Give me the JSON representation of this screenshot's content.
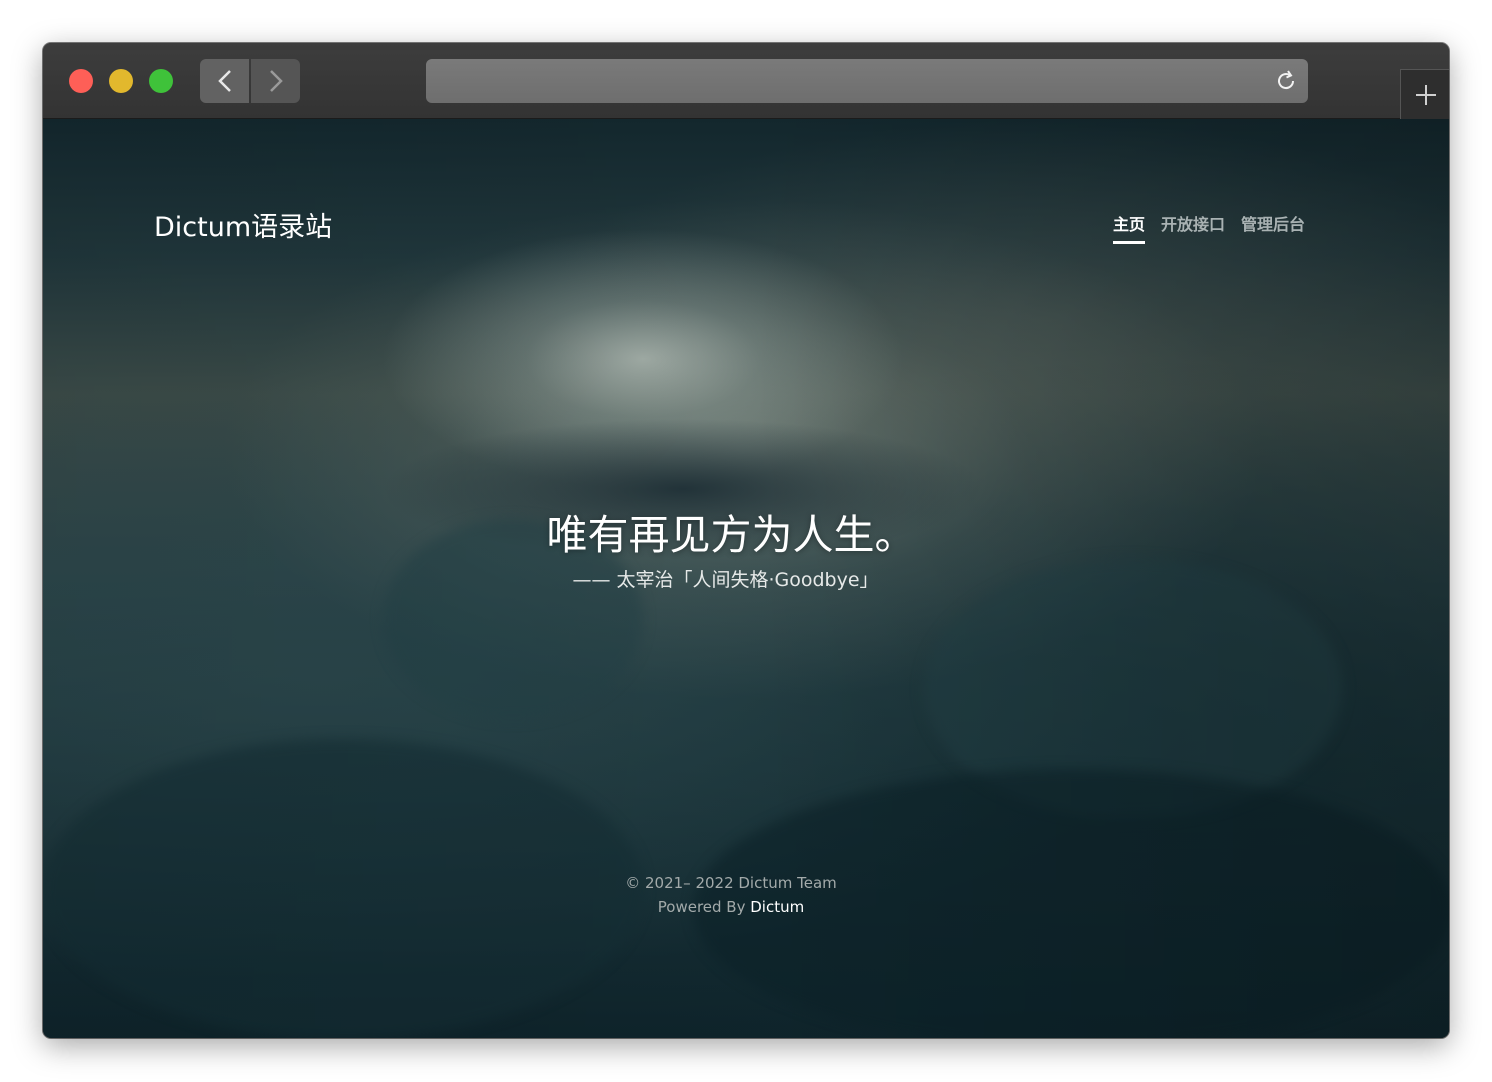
{
  "browser": {
    "address": "",
    "back_icon": "chevron-left-icon",
    "forward_icon": "chevron-right-icon",
    "reload_icon": "reload-icon",
    "new_tab_icon": "plus-icon",
    "traffic_lights": {
      "close": "#fe5f57",
      "minimize": "#e2b82d",
      "zoom": "#3fc23a"
    }
  },
  "site": {
    "brand": "Dictum语录站",
    "nav": [
      {
        "label": "主页",
        "active": true
      },
      {
        "label": "开放接口",
        "active": false
      },
      {
        "label": "管理后台",
        "active": false
      }
    ]
  },
  "hero": {
    "quote": "唯有再见方为人生。",
    "source": "—— 太宰治「人间失格·Goodbye」"
  },
  "footer": {
    "copyright": "© 2021– 2022 Dictum Team",
    "powered_prefix": "Powered By ",
    "powered_link": "Dictum"
  }
}
